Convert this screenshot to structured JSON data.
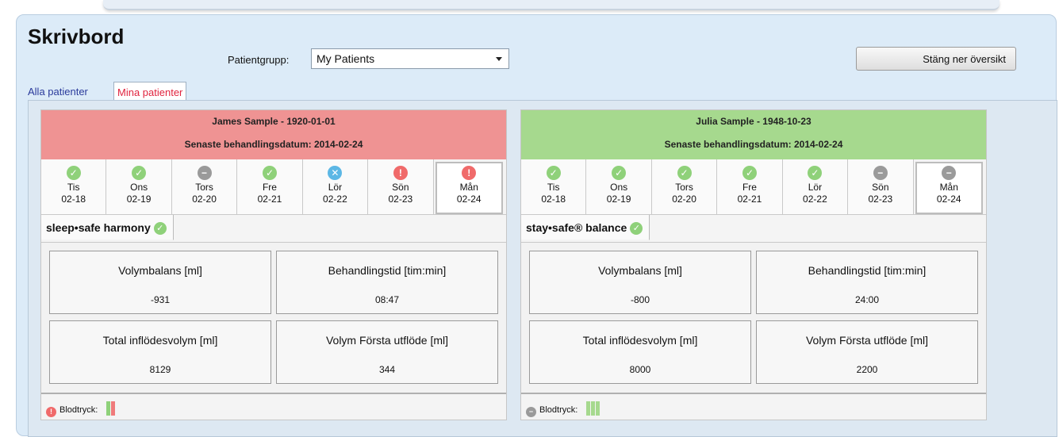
{
  "title": "Skrivbord",
  "group": {
    "label": "Patientgrupp:",
    "selected": "My Patients"
  },
  "close_button": "Stäng ner översikt",
  "tabs": [
    {
      "label": "Alla patienter",
      "active": false
    },
    {
      "label": "Mina patienter",
      "active": true
    }
  ],
  "patients": [
    {
      "name": "James Sample - 1920-01-01",
      "last_treatment": "Senaste behandlingsdatum: 2014-02-24",
      "header_color": "#ef9393",
      "days": [
        {
          "day": "Tis",
          "date": "02-18",
          "icon": "check-icon",
          "glyph": "✓"
        },
        {
          "day": "Ons",
          "date": "02-19",
          "icon": "check-icon",
          "glyph": "✓"
        },
        {
          "day": "Tors",
          "date": "02-20",
          "icon": "minus-icon",
          "glyph": "−"
        },
        {
          "day": "Fre",
          "date": "02-21",
          "icon": "check-icon",
          "glyph": "✓"
        },
        {
          "day": "Lör",
          "date": "02-22",
          "icon": "cross-icon",
          "glyph": "✕"
        },
        {
          "day": "Sön",
          "date": "02-23",
          "icon": "exclamation-icon",
          "glyph": "!"
        },
        {
          "day": "Mån",
          "date": "02-24",
          "icon": "exclamation-icon",
          "glyph": "!"
        }
      ],
      "device": "sleep•safe harmony",
      "device_glyph": "✓",
      "metrics": [
        {
          "label": "Volymbalans [ml]",
          "value": "-931"
        },
        {
          "label": "Behandlingstid [tim:min]",
          "value": "08:47"
        },
        {
          "label": "Total inflödesvolym [ml]",
          "value": "8129"
        },
        {
          "label": "Volym Första utflöde [ml]",
          "value": "344"
        }
      ],
      "bp_label": "Blodtryck:",
      "bp_glyph": "!"
    },
    {
      "name": "Julia Sample - 1948-10-23",
      "last_treatment": "Senaste behandlingsdatum: 2014-02-24",
      "header_color": "#a6d98e",
      "days": [
        {
          "day": "Tis",
          "date": "02-18",
          "icon": "check-icon",
          "glyph": "✓"
        },
        {
          "day": "Ons",
          "date": "02-19",
          "icon": "check-icon",
          "glyph": "✓"
        },
        {
          "day": "Tors",
          "date": "02-20",
          "icon": "check-icon",
          "glyph": "✓"
        },
        {
          "day": "Fre",
          "date": "02-21",
          "icon": "check-icon",
          "glyph": "✓"
        },
        {
          "day": "Lör",
          "date": "02-22",
          "icon": "check-icon",
          "glyph": "✓"
        },
        {
          "day": "Sön",
          "date": "02-23",
          "icon": "minus-icon",
          "glyph": "−"
        },
        {
          "day": "Mån",
          "date": "02-24",
          "icon": "minus-icon",
          "glyph": "−"
        }
      ],
      "device": "stay•safe® balance",
      "device_glyph": "✓",
      "metrics": [
        {
          "label": "Volymbalans [ml]",
          "value": "-800"
        },
        {
          "label": "Behandlingstid [tim:min]",
          "value": "24:00"
        },
        {
          "label": "Total inflödesvolym [ml]",
          "value": "8000"
        },
        {
          "label": "Volym Första utflöde [ml]",
          "value": "2200"
        }
      ],
      "bp_label": "Blodtryck:",
      "bp_glyph": "−"
    }
  ]
}
